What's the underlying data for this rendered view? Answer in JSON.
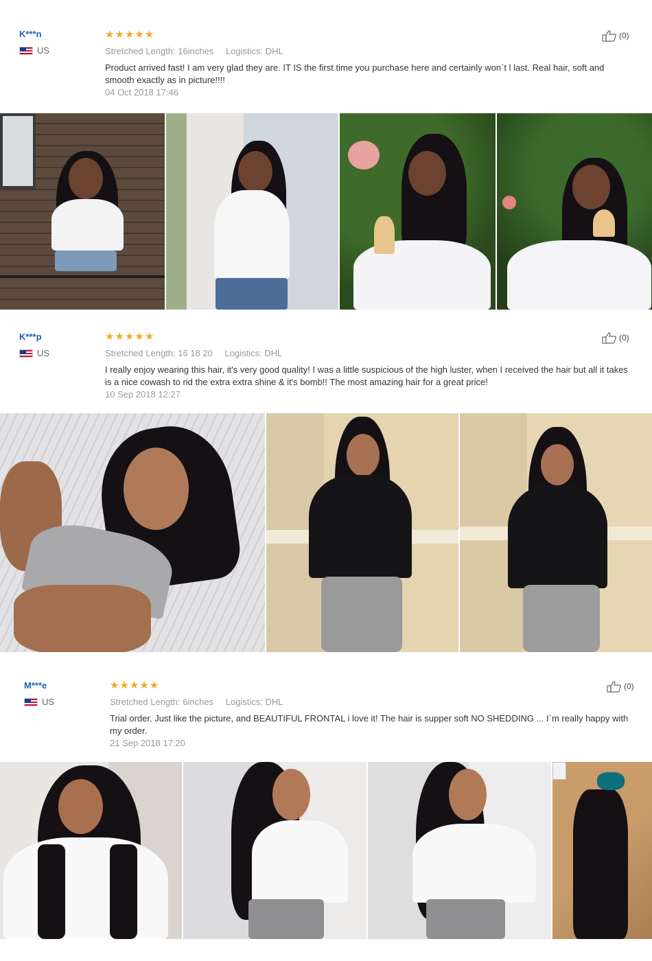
{
  "labels": {
    "stretched_length": "Stretched Length:",
    "logistics": "Logistics:"
  },
  "reviews": [
    {
      "username": "K***n",
      "country": "US",
      "rating": 5,
      "stretched_length": "16inches",
      "logistics": "DHL",
      "text": "Product arrived fast! I am very glad they are. IT IS the first time you purchase here and certainly won`t l last. Real hair, soft and smooth exactly as in picture!!!!",
      "date": "04 Oct 2018 17:46",
      "helpful": "(0)",
      "photos": [
        "photo-woman-white-tee-wood-wall",
        "photo-woman-white-tee-by-wall",
        "photo-woman-ice-cream-roses",
        "photo-woman-ice-cream-eating"
      ]
    },
    {
      "username": "K***p",
      "country": "US",
      "rating": 5,
      "stretched_length": "16 18 20",
      "logistics": "DHL",
      "text": "I really enjoy wearing this hair, it's very good quality! I was a little suspicious of the high luster, when I received the hair but all it takes is a nice cowash to rid the extra extra shine & it's bomb!! The most amazing hair for a great price!",
      "date": "10 Sep 2018 12:27",
      "helpful": "(0)",
      "photos": [
        "photo-selfie-gray-top",
        "photo-black-tee-joggers-front",
        "photo-black-tee-joggers-side"
      ]
    },
    {
      "username": "M***e",
      "country": "US",
      "rating": 5,
      "stretched_length": "6inches",
      "logistics": "DHL",
      "text": "Trial order. Just like the picture, and BEAUTIFUL FRONTAL i love it! The hair is supper soft NO SHEDDING ... I`m really happy with my order.",
      "date": "21 Sep 2018 17:20",
      "helpful": "(0)",
      "photos": [
        "photo-white-wrap-top-1",
        "photo-white-wrap-top-2",
        "photo-white-wrap-top-3",
        "photo-hair-bundles"
      ]
    }
  ],
  "colors": {
    "username": "#1f5fb4",
    "star": "#f5a623",
    "muted": "#999999"
  }
}
